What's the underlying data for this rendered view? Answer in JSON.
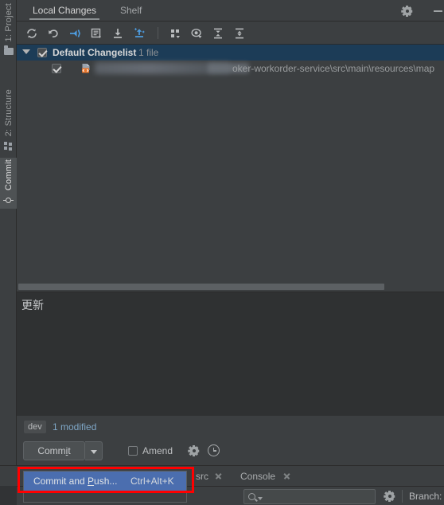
{
  "sidebar": {
    "items": [
      {
        "label": "1: Project",
        "icon": "folder-icon",
        "selected": false
      },
      {
        "label": "2: Structure",
        "icon": "structure-icon",
        "selected": false
      },
      {
        "label": "Commit",
        "icon": "commit-icon",
        "selected": true
      }
    ]
  },
  "header": {
    "tabs": [
      {
        "label": "Local Changes",
        "active": true
      },
      {
        "label": "Shelf",
        "active": false
      }
    ],
    "settings_icon": "gear-icon",
    "minimize_icon": "minimize-icon"
  },
  "toolbar": {
    "buttons": [
      {
        "name": "refresh-button",
        "icon": "refresh-icon",
        "tooltip": "Refresh"
      },
      {
        "name": "rollback-button",
        "icon": "rollback-icon",
        "tooltip": "Rollback"
      },
      {
        "name": "shelve-button",
        "icon": "shelve-icon",
        "tooltip": "Shelve Silently"
      },
      {
        "name": "show-diff-button",
        "icon": "diff-icon",
        "tooltip": "Show Diff"
      },
      {
        "name": "update-button",
        "icon": "download-icon",
        "tooltip": "Update Project"
      },
      {
        "name": "commit-button",
        "icon": "commit-arrow-icon",
        "tooltip": "Commit"
      },
      {
        "name": "group-by-button",
        "icon": "group-by-icon",
        "tooltip": "Group By"
      },
      {
        "name": "preview-diff-button",
        "icon": "eye-icon",
        "tooltip": "Preview Diff"
      },
      {
        "name": "expand-all-button",
        "icon": "expand-all-icon",
        "tooltip": "Expand All"
      },
      {
        "name": "collapse-all-button",
        "icon": "collapse-all-icon",
        "tooltip": "Collapse All"
      }
    ]
  },
  "changelist": {
    "expanded": true,
    "checked": true,
    "name": "Default Changelist",
    "count_label": "1 file",
    "files": [
      {
        "checked": true,
        "icon": "xml-file-icon",
        "path": "oker-workorder-service\\src\\main\\resources\\map",
        "redacted": true
      }
    ]
  },
  "scrollbar": {
    "orientation": "horizontal",
    "thumb_ratio": 0.86
  },
  "commit_message": {
    "value": "更新",
    "placeholder": ""
  },
  "status": {
    "branch_chip": "dev",
    "modified_label": "1 modified"
  },
  "commit_bar": {
    "commit_label": "Commit",
    "commit_mnemonic": "i",
    "dropdown_icon": "chevron-down-icon",
    "amend_label": "Amend",
    "amend_checked": false,
    "settings_icon": "gear-icon",
    "history_icon": "clock-icon"
  },
  "popup_menu": {
    "items": [
      {
        "label_pre": "Commit and ",
        "label_mnemonic": "P",
        "label_post": "ush...",
        "shortcut": "Ctrl+Alt+K",
        "highlighted": true
      }
    ]
  },
  "bottom_tabs": [
    {
      "label": "src",
      "closable": true
    },
    {
      "label": "Console",
      "closable": true
    }
  ],
  "bottom_bar": {
    "search_placeholder": "",
    "search_value": "",
    "search_icon": "search-icon",
    "settings_icon": "gear-icon",
    "branch_label": "Branch:"
  },
  "annotation": {
    "type": "rectangle",
    "color": "#ff0000"
  },
  "colors": {
    "background": "#3c3f41",
    "editor_background": "#2f3132",
    "selection_tree": "#1c3c57",
    "selection_menu": "#4b6eaf",
    "accent_blue": "#4e9ee3",
    "link_blue": "#7fa7c7",
    "annotation_red": "#ff0000"
  }
}
